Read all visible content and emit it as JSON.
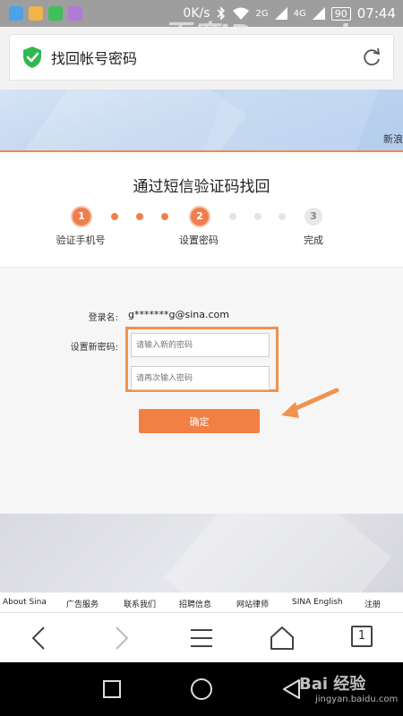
{
  "status_bar": {
    "speed": "0K/s",
    "signal_1": "2G",
    "signal_2": "4G",
    "battery": "90",
    "time": "07:44",
    "watermark": "百度ID guozi"
  },
  "header": {
    "title": "找回帐号密码"
  },
  "banner": {
    "text": "新浪"
  },
  "steps": {
    "heading": "通过短信验证码找回",
    "items": [
      {
        "number": "1",
        "label": "验证手机号",
        "state": "active"
      },
      {
        "number": "2",
        "label": "设置密码",
        "state": "active"
      },
      {
        "number": "3",
        "label": "完成",
        "state": "inactive"
      }
    ]
  },
  "form": {
    "login_label": "登录名:",
    "login_value": "g*******g@sina.com",
    "new_password_label": "设置新密码:",
    "password_placeholder": "请输入新的密码",
    "confirm_placeholder": "请再次输入密码",
    "submit_label": "确定"
  },
  "footer": {
    "links": [
      "About Sina",
      "广告服务",
      "联系我们",
      "招聘信息",
      "网站律师",
      "SINA English",
      "注册"
    ]
  },
  "toolbar": {
    "tab_count": "1"
  },
  "nav": {
    "baidu_logo": "Bai 经验",
    "baidu_url": "jingyan.baidu.com"
  },
  "colors": {
    "accent": "#ee7e4e",
    "button": "#f27f43",
    "highlight": "#f0924f"
  }
}
